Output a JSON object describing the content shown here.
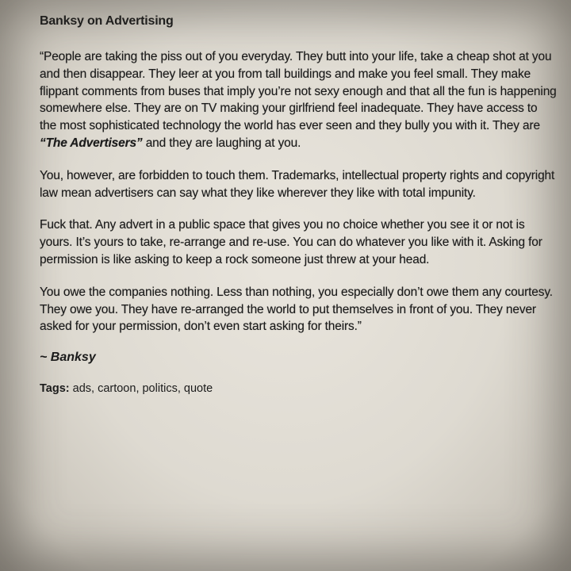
{
  "title": "Banksy on Advertising",
  "paragraphs": {
    "p1_before_em": "“People are taking the piss out of you everyday. They butt into your life, take a cheap shot at you and then disappear. They leer at you from tall buildings and make you feel small. They make flippant comments from buses that imply you’re not sexy enough and that all the fun is happening somewhere else. They are on TV making your girlfriend feel inadequate. They have access to the most sophisticated technology the world has ever seen and they bully you with it. They are ",
    "p1_em": "“The Advertisers”",
    "p1_after_em": " and they are laughing at you.",
    "p2": "You, however, are forbidden to touch them. Trademarks, intellectual property rights and copyright law mean advertisers can say what they like wherever they like with total impunity.",
    "p3": "Fuck that. Any advert in a public space that gives you no choice whether you see it or not is yours. It’s yours to take, re-arrange and re-use. You can do whatever you like with it. Asking for permission is like asking to keep a rock someone just threw at your head.",
    "p4": "You owe the companies nothing. Less than nothing, you especially don’t owe them any courtesy. They owe you. They have re-arranged the world to put themselves in front of you. They never asked for your permission, don’t even start asking for theirs.”"
  },
  "signature": "~ Banksy",
  "tags": {
    "label": "Tags:",
    "values": "ads, cartoon, politics, quote"
  }
}
